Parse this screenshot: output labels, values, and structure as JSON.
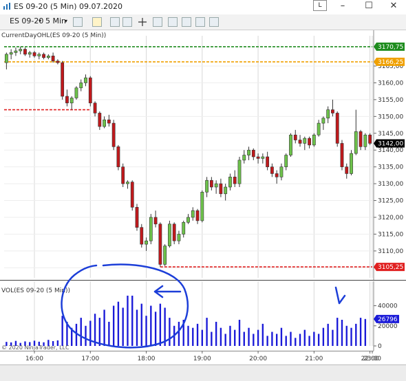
{
  "window": {
    "title": "ES 09-20 (5 Min)  09.07.2020",
    "layout_button": "L",
    "minimize": "–",
    "maximize": "☐",
    "close": "✕"
  },
  "toolbar": {
    "instrument": "ES 09-20",
    "interval": "5 Min",
    "dropdown_icon": "▾"
  },
  "indicators": {
    "main_label": "CurrentDayOHL(ES 09-20 (5 Min))",
    "vol_label": "VOL(ES 09-20 (5 Min))",
    "copyright": "© 2020 NinjaTrader, LLC"
  },
  "colors": {
    "up_candle": "#6dc24b",
    "down_candle": "#c0191c",
    "high_line": "#1e8c1e",
    "open_line": "#f0a000",
    "low_line": "#e02020",
    "current_price_tag": "#000000",
    "volume_bar": "#1a1ad8",
    "annotation": "#1c3ed8",
    "grid": "#d8d8d8"
  },
  "chart_data": [
    {
      "type": "candlestick",
      "title": "CurrentDayOHL(ES 09-20 (5 Min))",
      "x_ticks": [
        "16:00",
        "17:00",
        "18:00",
        "19:00",
        "20:00",
        "21:00",
        "22:00",
        "23:00"
      ],
      "ylim": [
        3102,
        3174
      ],
      "y_ticks": [
        3105,
        3110,
        3115,
        3120,
        3125,
        3130,
        3135,
        3140,
        3145,
        3150,
        3155,
        3160,
        3165
      ],
      "levels": [
        {
          "name": "high",
          "value": 3170.75,
          "label": "3170,75"
        },
        {
          "name": "open",
          "value": 3166.25,
          "label": "3166,25"
        },
        {
          "name": "low",
          "value": 3105.25,
          "label": "3105,25"
        }
      ],
      "current_price": {
        "value": 3142.0,
        "label": "3142,00"
      },
      "candles": [
        [
          3166.0,
          3169.0,
          3164.0,
          3168.5
        ],
        [
          3168.5,
          3170.0,
          3167.0,
          3169.0
        ],
        [
          3169.0,
          3170.5,
          3168.0,
          3169.5
        ],
        [
          3169.5,
          3170.75,
          3168.5,
          3170.0
        ],
        [
          3170.0,
          3170.5,
          3168.0,
          3168.5
        ],
        [
          3168.5,
          3169.5,
          3167.5,
          3169.0
        ],
        [
          3169.0,
          3169.5,
          3167.5,
          3168.0
        ],
        [
          3168.0,
          3169.0,
          3167.0,
          3168.5
        ],
        [
          3168.5,
          3169.0,
          3167.0,
          3167.5
        ],
        [
          3167.5,
          3168.5,
          3167.0,
          3168.0
        ],
        [
          3168.0,
          3169.0,
          3166.0,
          3166.5
        ],
        [
          3166.5,
          3167.0,
          3165.5,
          3166.0
        ],
        [
          3166.0,
          3166.5,
          3155.0,
          3156.0
        ],
        [
          3156.0,
          3158.0,
          3153.0,
          3154.0
        ],
        [
          3154.0,
          3156.0,
          3152.0,
          3155.5
        ],
        [
          3155.5,
          3159.0,
          3155.0,
          3158.5
        ],
        [
          3158.5,
          3161.0,
          3157.5,
          3160.0
        ],
        [
          3160.0,
          3162.5,
          3159.0,
          3161.5
        ],
        [
          3161.5,
          3162.0,
          3153.0,
          3154.0
        ],
        [
          3154.0,
          3154.5,
          3150.0,
          3151.0
        ],
        [
          3151.0,
          3151.5,
          3146.0,
          3147.0
        ],
        [
          3147.0,
          3150.0,
          3146.5,
          3149.0
        ],
        [
          3149.0,
          3150.5,
          3147.0,
          3148.0
        ],
        [
          3148.0,
          3149.0,
          3140.0,
          3141.0
        ],
        [
          3141.0,
          3141.5,
          3134.0,
          3135.0
        ],
        [
          3135.0,
          3136.0,
          3129.0,
          3130.0
        ],
        [
          3130.0,
          3131.0,
          3128.5,
          3130.5
        ],
        [
          3130.5,
          3131.0,
          3122.0,
          3123.0
        ],
        [
          3123.0,
          3124.0,
          3116.0,
          3117.0
        ],
        [
          3117.0,
          3118.0,
          3111.0,
          3112.0
        ],
        [
          3112.0,
          3114.0,
          3110.0,
          3113.0
        ],
        [
          3113.0,
          3121.0,
          3112.0,
          3120.0
        ],
        [
          3120.0,
          3122.0,
          3117.0,
          3118.0
        ],
        [
          3118.0,
          3118.5,
          3105.25,
          3106.0
        ],
        [
          3106.0,
          3112.0,
          3105.5,
          3111.5
        ],
        [
          3111.5,
          3119.0,
          3111.0,
          3118.0
        ],
        [
          3118.0,
          3118.5,
          3112.0,
          3113.0
        ],
        [
          3113.0,
          3116.0,
          3112.0,
          3115.0
        ],
        [
          3115.0,
          3119.0,
          3114.0,
          3118.5
        ],
        [
          3118.5,
          3121.0,
          3118.0,
          3120.0
        ],
        [
          3120.0,
          3123.0,
          3119.0,
          3122.0
        ],
        [
          3122.0,
          3122.5,
          3118.0,
          3119.0
        ],
        [
          3119.0,
          3128.0,
          3118.5,
          3127.5
        ],
        [
          3127.5,
          3132.0,
          3126.0,
          3131.0
        ],
        [
          3131.0,
          3132.0,
          3128.0,
          3129.0
        ],
        [
          3129.0,
          3131.0,
          3127.0,
          3130.0
        ],
        [
          3130.0,
          3131.5,
          3126.0,
          3127.0
        ],
        [
          3127.0,
          3130.0,
          3125.0,
          3129.0
        ],
        [
          3129.0,
          3133.0,
          3128.0,
          3132.0
        ],
        [
          3132.0,
          3134.0,
          3129.0,
          3130.0
        ],
        [
          3130.0,
          3138.0,
          3129.0,
          3137.0
        ],
        [
          3137.0,
          3140.0,
          3136.0,
          3138.5
        ],
        [
          3138.5,
          3141.0,
          3137.0,
          3140.0
        ],
        [
          3140.0,
          3140.5,
          3137.0,
          3138.0
        ],
        [
          3138.0,
          3139.0,
          3136.0,
          3137.5
        ],
        [
          3137.5,
          3139.0,
          3136.0,
          3138.0
        ],
        [
          3138.0,
          3139.5,
          3134.0,
          3135.0
        ],
        [
          3135.0,
          3136.0,
          3132.0,
          3133.0
        ],
        [
          3133.0,
          3134.0,
          3130.0,
          3132.0
        ],
        [
          3132.0,
          3136.0,
          3131.0,
          3135.0
        ],
        [
          3135.0,
          3139.0,
          3134.0,
          3138.5
        ],
        [
          3138.5,
          3145.0,
          3138.0,
          3144.5
        ],
        [
          3144.5,
          3146.0,
          3142.0,
          3143.0
        ],
        [
          3143.0,
          3144.5,
          3141.0,
          3142.0
        ],
        [
          3142.0,
          3144.0,
          3140.0,
          3143.5
        ],
        [
          3143.5,
          3144.0,
          3140.5,
          3141.5
        ],
        [
          3141.5,
          3145.0,
          3141.0,
          3144.5
        ],
        [
          3144.5,
          3149.0,
          3144.0,
          3148.0
        ],
        [
          3148.0,
          3150.0,
          3146.0,
          3149.5
        ],
        [
          3149.5,
          3153.0,
          3148.0,
          3152.0
        ],
        [
          3152.0,
          3155.0,
          3150.0,
          3151.0
        ],
        [
          3151.0,
          3151.5,
          3141.0,
          3142.0
        ],
        [
          3142.0,
          3143.0,
          3134.0,
          3135.0
        ],
        [
          3135.0,
          3136.0,
          3131.5,
          3133.0
        ],
        [
          3133.0,
          3140.0,
          3132.5,
          3139.0
        ],
        [
          3139.0,
          3152.0,
          3138.5,
          3145.5
        ],
        [
          3145.5,
          3146.0,
          3140.0,
          3141.0
        ],
        [
          3141.0,
          3145.0,
          3140.0,
          3144.5
        ],
        [
          3144.5,
          3145.0,
          3141.5,
          3142.0
        ]
      ]
    },
    {
      "type": "bar",
      "title": "VOL(ES 09-20 (5 Min))",
      "ylim": [
        0,
        52000
      ],
      "y_ticks": [
        0,
        20000,
        40000
      ],
      "y_tick_labels": [
        "0",
        "20000",
        "40000"
      ],
      "current_value": {
        "value": 26796,
        "label": "26796"
      },
      "values": [
        4000,
        3500,
        5000,
        3000,
        4500,
        3800,
        5200,
        4200,
        3600,
        6000,
        4800,
        5500,
        30000,
        24000,
        18000,
        22000,
        28000,
        20000,
        25000,
        32000,
        28000,
        36000,
        24000,
        40000,
        44000,
        38000,
        50000,
        50000,
        36000,
        42000,
        30000,
        40000,
        34000,
        42000,
        38000,
        28000,
        20000,
        24000,
        26000,
        20000,
        18000,
        22000,
        16000,
        28000,
        14000,
        24000,
        18000,
        12000,
        20000,
        16000,
        26000,
        14000,
        18000,
        12000,
        16000,
        22000,
        10000,
        14000,
        12000,
        18000,
        10000,
        14000,
        8000,
        12000,
        16000,
        10000,
        14000,
        12000,
        18000,
        22000,
        16000,
        28000,
        26000,
        20000,
        18000,
        22000,
        28000,
        26796
      ]
    }
  ]
}
